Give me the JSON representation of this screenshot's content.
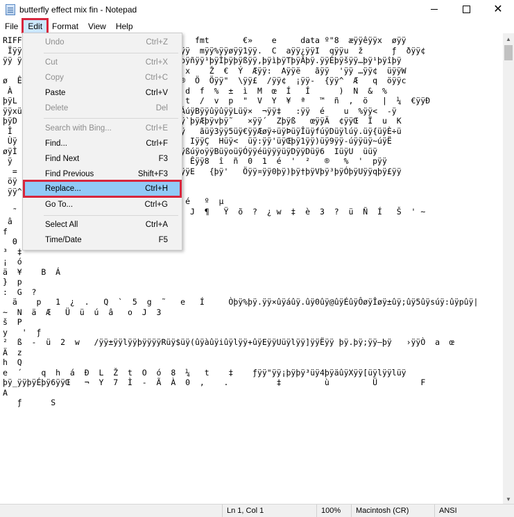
{
  "window": {
    "title": "butterfly effect mix fin - Notepad",
    "controls": {
      "minimize": "–",
      "maximize": "□",
      "close": "✕"
    }
  },
  "menubar": {
    "items": [
      {
        "label": "File"
      },
      {
        "label": "Edit",
        "active": true
      },
      {
        "label": "Format"
      },
      {
        "label": "View"
      },
      {
        "label": "Help"
      }
    ]
  },
  "edit_menu": {
    "items": [
      {
        "label": "Undo",
        "shortcut": "Ctrl+Z",
        "enabled": false
      },
      {
        "label": "Cut",
        "shortcut": "Ctrl+X",
        "enabled": false
      },
      {
        "label": "Copy",
        "shortcut": "Ctrl+C",
        "enabled": false
      },
      {
        "label": "Paste",
        "shortcut": "Ctrl+V",
        "enabled": true
      },
      {
        "label": "Delete",
        "shortcut": "Del",
        "enabled": false
      },
      {
        "label": "Search with Bing...",
        "shortcut": "Ctrl+E",
        "enabled": false
      },
      {
        "label": "Find...",
        "shortcut": "Ctrl+F",
        "enabled": true
      },
      {
        "label": "Find Next",
        "shortcut": "F3",
        "enabled": true
      },
      {
        "label": "Find Previous",
        "shortcut": "Shift+F3",
        "enabled": true
      },
      {
        "label": "Replace...",
        "shortcut": "Ctrl+H",
        "enabled": true,
        "highlighted": true
      },
      {
        "label": "Go To...",
        "shortcut": "Ctrl+G",
        "enabled": true
      },
      {
        "label": "Select All",
        "shortcut": "Ctrl+A",
        "enabled": true
      },
      {
        "label": "Time/Date",
        "shortcut": "F5",
        "enabled": true
      }
    ]
  },
  "editor": {
    "lines": [
      "RIFF                                    fmt       €»    e     data º\"8  æÿÿêÿÿx  øÿÿ",
      " Ïÿÿ                                Àÿÿ  mÿÿ%ÿÿøÿÿ1ÿÿ.  C  aÿÿ¿ÿÿI  qÿÿu  ž      ƒ  ðÿÿ¢",
      "ÿÿ ÿ                        þÿ¿þÿÍþÿÜþÿñÿÿ¹þÿÌþÿþÿßÿÿ,þÿìþÿTþÿÂþÿ.ÿÿÉþÿšÿÿ…þÿ¹þÿîþÿ",
      "    |                       r   \"  „  x    Ž  €  Ý  Æÿÿ:  Aÿÿë   ãÿÿ  'ÿÿ …ÿÿ¢  üÿÿW",
      "ø  Ê                           ;  Ý  ®  Ö  Öÿÿ\"  \\ÿÿ£  /ÿÿ¢  ¡ÿÿ-  {ÿÿ^  Æ   q  öÿÿc",
      " À                        e   Ñ    ¦  d  f  %  ±  ì  M  œ  Í   Í      )  N  &  %",
      "þÿL                       ,  »  C  €  t  /  v  p  \"  V  Y  ¥  ª   ™  ñ  ,  ö   |  ¼  €ÿÿÐ",
      "ÿÿxü                   ÿÿ|úÿõüÿXúÿóþÿÁúÿBÿÿûÿûÿÿLüÿ×  ¬ÿÿ‡   :ÿÿ  é    u  %ÿÿ<  -ÿ",
      "þÿD                    %üÿÿÿª¤üÿƒþÿ'ÿÿ`þÿÆþÿvþÿ˜   ×ÿÿ´  Zþÿß   œÿÿÄ  ¢ÿÿŒ  Ï  u  K",
      " Î                     ÿó   «ÿÿf   *üÿ   ãüÿ3ÿÿ5üÿ€ÿÿÆøÿ÷üÿÞüÿÎüÿfúÿDüÿlúÿ.üÿ{üÿÈ÷ü",
      " Ùÿ                    ™  àÿÿ«   «Þÿ   IÿÿÇ  Hüÿ<  üÿ:ÿÿ'üÿŒþÿ1ÿÿ)üÿ9ÿÿ-úÿÿüÿ~úÿË",
      "øÿÌ                    üÿLÿÿ%øÿÿÉüÿºÿÿßúÿoÿÿBüÿoüÿÓÿÿéüÿÿÿüÿDÿÿDüÿ6  IüÿU  üüÿ",
      " ÿ   P                 ÿÿ1  ÿÿú  †ÿÿu  Êÿÿ8  î  ñ  0  1  é  '  ²   ®   %  '  pÿÿ",
      "  =                    5  w  Úÿÿv   …ÿÿE   {þÿ'   Öÿÿ¤ÿÿ0þÿ)þÿ†þÿVþÿ³þÿÓþÿUÿÿqþÿ£ÿÿ",
      " öÿ",
      " ÿÿ^",
      "                        úÿ  g  Θ   c  é   º  µ",
      "  ˜  s   A   §    X  1  O   <  O   |   J  ¶   Ÿ  õ  ?  ¿ w  ‡  è  3  ?  ü  Ñ  Í   Š  ' ~",
      " â",
      "f    ?  Ù  ¢    Θ",
      "  Θ",
      "³  ‡",
      "¡  ó",
      "ä  ¥    B  Á",
      "}  p",
      ":  G  ?",
      "  ä    p   1  ¿  .   Q  `  5  g  ˜   e   Í     Òþÿ%þÿ.ÿÿ×ûÿáûÿ.ûÿ0ûÿ@ûÿÉûÿÔøÿÎøÿ±ûÿ;ûÿ5ûÿsúÿ:ûÿpûÿ|",
      "~  N  ä  Æ   Ü  ü  ú  â   o  J  3",
      "š  P",
      "y   '  ƒ",
      "²  ß  -  ü  2  w   /ÿÿ±ÿÿlÿÿþÿÿÿÿRüÿ$üÿ(ûÿàûÿiûÿlÿÿ+ûÿEÿÿUüÿlÿÿ]ÿÿËÿÿ þÿ.þÿ;ÿÿ—þÿ   ›ÿÿÒ  a  œ",
      "Ä  z",
      "h  Q",
      "e  ´    q  h  á  Ð  L  Ž  t  O  ó  8  ¼   t    ‡    ƒÿÿ\"ÿÿ¡þÿþÿ³üÿ4þÿäûÿXÿÿ[üÿlÿÿlüÿ",
      "þÿ_ÿÿþÿÉþÿ6ÿÿŒ   ¬  Y  7  Ì  -  Ã  À  0  ,    .          ‡         ù         Ü         F",
      "A",
      "   ƒ      S"
    ]
  },
  "statusbar": {
    "position": "Ln 1, Col 1",
    "zoom": "100%",
    "line_ending": "Macintosh (CR)",
    "encoding": "ANSI"
  },
  "colors": {
    "highlight_outline": "#d7263d",
    "menu_hover": "#91c9f7",
    "active_menu_bg": "#cce8ff"
  }
}
